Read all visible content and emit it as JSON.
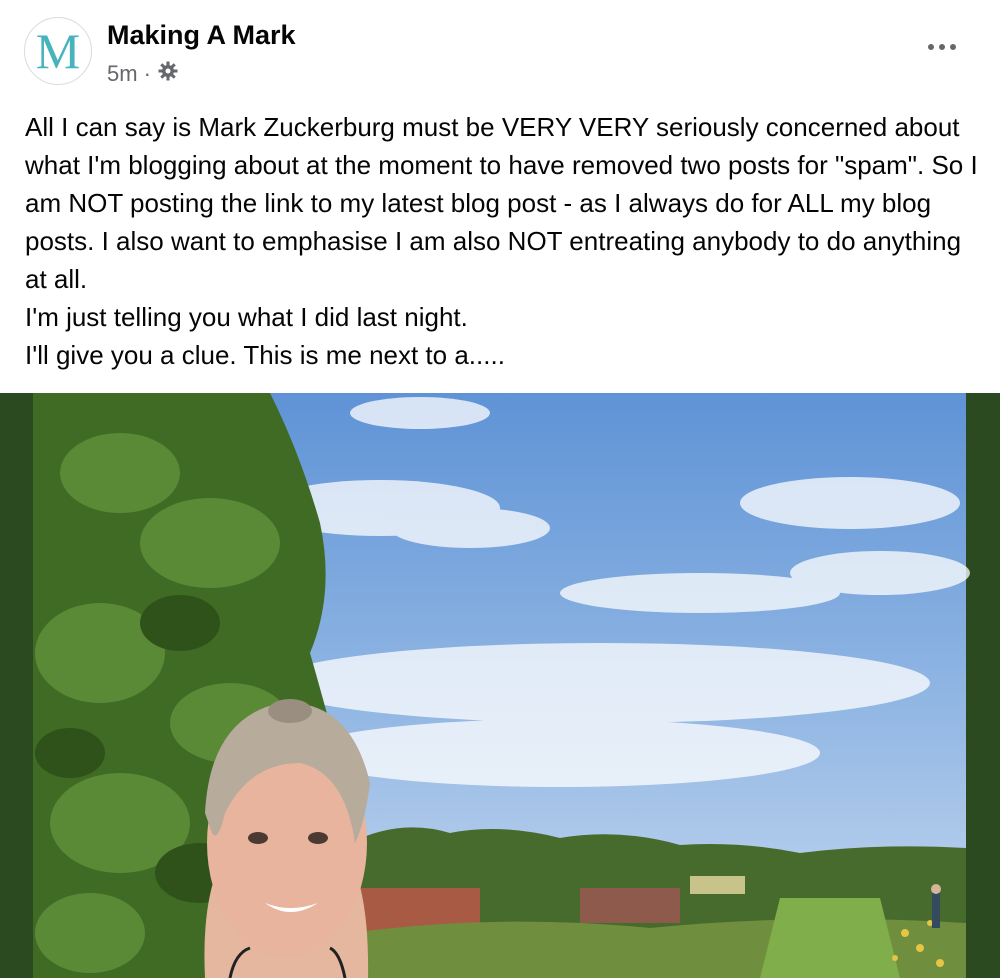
{
  "post": {
    "avatar_letter": "M",
    "author": "Making A Mark",
    "time": "5m",
    "meta_separator": "·",
    "privacy_icon": "gear-icon",
    "more_icon": "more-options-icon",
    "text_lines": [
      "All I can say is Mark Zuckerburg must be VERY VERY seriously concerned about what I'm blogging about at the moment to have removed two posts for \"spam\". So I am NOT posting the link to my latest blog post - as I always do for ALL my blog posts. I also want to emphasise I am also NOT entreating anybody to do anything at all.",
      "I'm just telling you what I did last night.",
      "I'll give you a clue. This is me next to a....."
    ]
  },
  "colors": {
    "avatar_letter": "#46b3bd",
    "photo_border": "#2b4a1f",
    "secondary_text": "#65676b"
  }
}
